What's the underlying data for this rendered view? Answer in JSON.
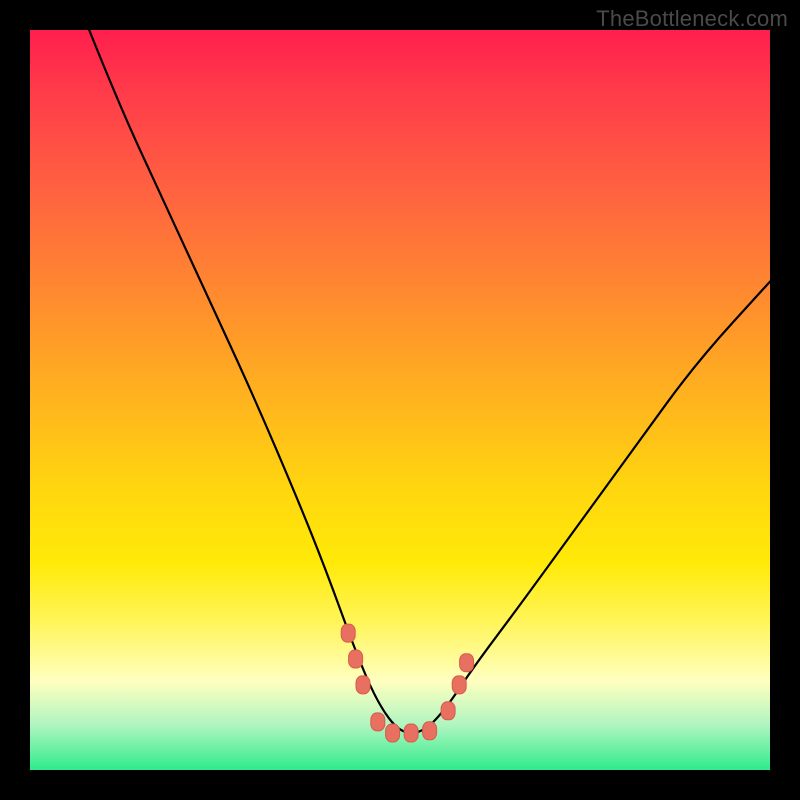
{
  "watermark": "TheBottleneck.com",
  "chart_data": {
    "type": "line",
    "title": "",
    "xlabel": "",
    "ylabel": "",
    "x_range_pct": [
      0,
      100
    ],
    "y_range_pct": [
      0,
      100
    ],
    "series": [
      {
        "name": "bottleneck-curve",
        "description": "V-shaped bottleneck curve plotted over vertical red→green gradient background; trough near x≈50%",
        "x": [
          8,
          12,
          18,
          24,
          30,
          36,
          40,
          44,
          47,
          50,
          53,
          56,
          60,
          66,
          74,
          82,
          90,
          100
        ],
        "y": [
          100,
          90,
          77,
          64,
          51,
          37,
          27,
          16,
          9,
          5,
          5,
          8,
          14,
          22,
          33,
          44,
          55,
          66
        ]
      }
    ],
    "markers": {
      "description": "Salmon squircle markers clustered near trough of curve",
      "points_pct": [
        {
          "x": 43.0,
          "y": 18.5
        },
        {
          "x": 44.0,
          "y": 15.0
        },
        {
          "x": 45.0,
          "y": 11.5
        },
        {
          "x": 47.0,
          "y": 6.5
        },
        {
          "x": 49.0,
          "y": 5.0
        },
        {
          "x": 51.5,
          "y": 5.0
        },
        {
          "x": 54.0,
          "y": 5.3
        },
        {
          "x": 56.5,
          "y": 8.0
        },
        {
          "x": 58.0,
          "y": 11.5
        },
        {
          "x": 59.0,
          "y": 14.5
        }
      ]
    },
    "gradient_stops": [
      {
        "pct": 0,
        "color": "#ff1f4d"
      },
      {
        "pct": 50,
        "color": "#ffb41e"
      },
      {
        "pct": 72,
        "color": "#ffea08"
      },
      {
        "pct": 94,
        "color": "#aef5c0"
      },
      {
        "pct": 100,
        "color": "#2eec8a"
      }
    ]
  }
}
